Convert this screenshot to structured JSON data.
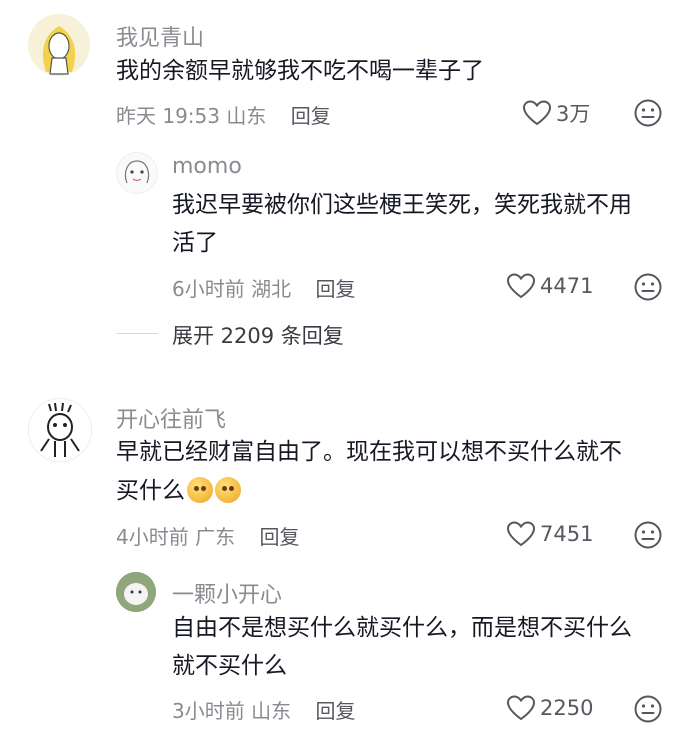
{
  "comments": [
    {
      "username": "我见青山",
      "line1": "我的余额早就够我不吃不喝一辈子了",
      "time": "昨天 19:53",
      "location": "山东",
      "reply_label": "回复",
      "likes": "3万",
      "avatar_icon": "cartoon-avatar-icon",
      "replies": [
        {
          "username": "momo",
          "line1": "我迟早要被你们这些梗王笑死，笑死我就不用",
          "line2": "活了",
          "time": "6小时前",
          "location": "湖北",
          "reply_label": "回复",
          "likes": "4471",
          "avatar_icon": "sketch-avatar-icon"
        }
      ],
      "expand_label": "展开 2209 条回复"
    },
    {
      "username": "开心往前飞",
      "line1": "早就已经财富自由了。现在我可以想不买什么就不",
      "line2": "买什么",
      "emoji": "coin-face-emoji",
      "time": "4小时前",
      "location": "广东",
      "reply_label": "回复",
      "likes": "7451",
      "avatar_icon": "doodle-avatar-icon",
      "replies": [
        {
          "username": "一颗小开心",
          "line1": "自由不是想买什么就买什么，而是想不买什么",
          "line2": "就不买什么",
          "time": "3小时前",
          "location": "山东",
          "reply_label": "回复",
          "likes": "2250",
          "avatar_icon": "photo-avatar-icon"
        }
      ]
    }
  ],
  "colors": {
    "text": "#161823",
    "meta": "#8a8b91",
    "divider": "#d9d9d9"
  }
}
